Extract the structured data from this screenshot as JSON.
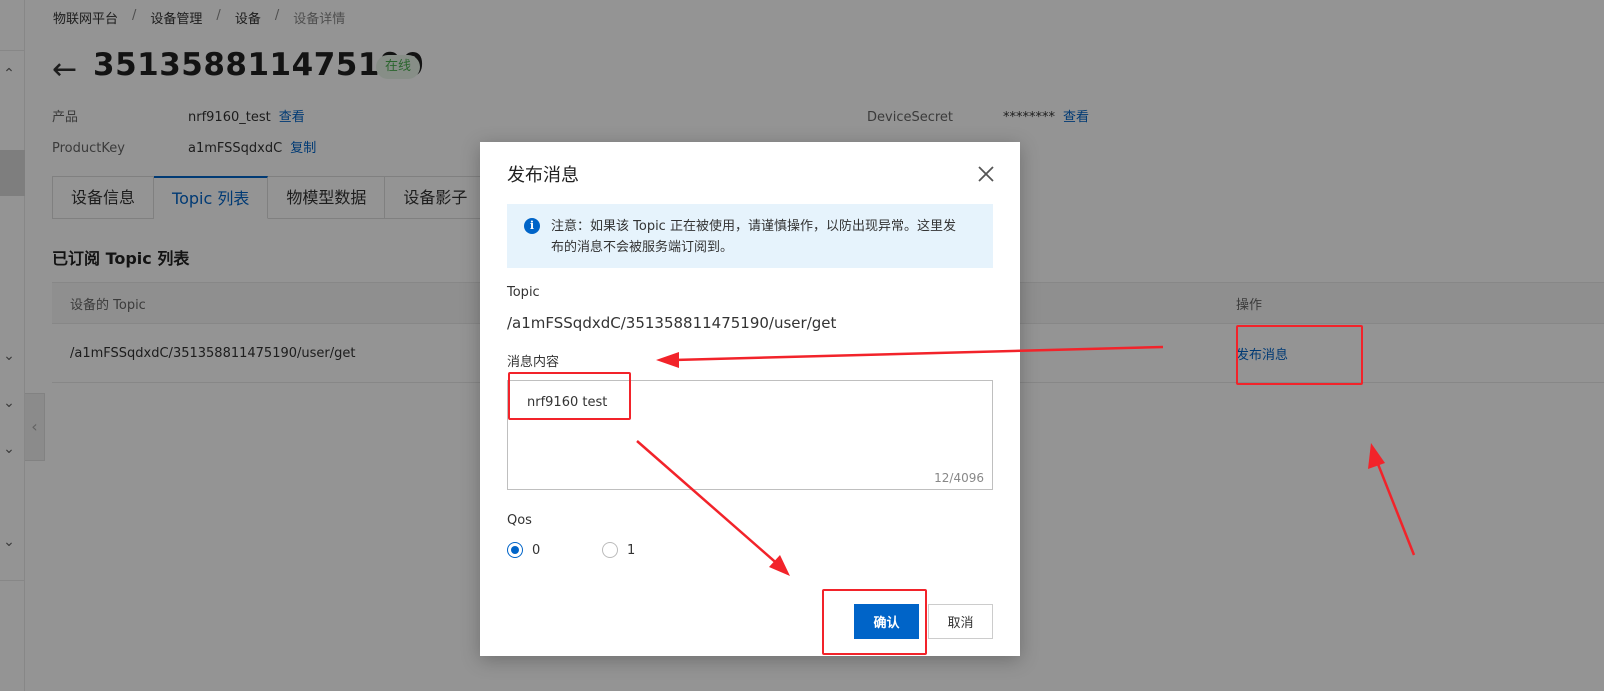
{
  "breadcrumb": {
    "items": [
      "物联网平台",
      "设备管理",
      "设备",
      "设备详情"
    ],
    "separator": "/"
  },
  "device": {
    "name": "351358811475190",
    "status": "在线"
  },
  "meta": {
    "product_label": "产品",
    "product_value": "nrf9160_test",
    "product_link": "查看",
    "productkey_label": "ProductKey",
    "productkey_value": "a1mFSSqdxdC",
    "productkey_link": "复制",
    "secret_label": "DeviceSecret",
    "secret_value": "********",
    "secret_link": "查看"
  },
  "tabs": [
    {
      "label": "设备信息",
      "active": false
    },
    {
      "label": "Topic 列表",
      "active": true
    },
    {
      "label": "物模型数据",
      "active": false
    },
    {
      "label": "设备影子",
      "active": false
    }
  ],
  "section_title": "已订阅 Topic 列表",
  "table": {
    "headers": {
      "topic": "设备的 Topic",
      "ops": "操作"
    },
    "rows": [
      {
        "topic": "/a1mFSSqdxdC/351358811475190/user/get",
        "action": "发布消息"
      }
    ]
  },
  "dialog": {
    "title": "发布消息",
    "notice_line1": "注意：如果该 Topic 正在被使用，请谨慎操作，以防出现异常。这里发",
    "notice_line2": "布的消息不会被服务端订阅到。",
    "topic_label": "Topic",
    "topic_value": "/a1mFSSqdxdC/351358811475190/user/get",
    "content_label": "消息内容",
    "content_value": "nrf9160 test",
    "content_counter": "12/4096",
    "qos_label": "Qos",
    "qos_options": [
      "0",
      "1"
    ],
    "qos_selected": "0",
    "confirm_label": "确认",
    "cancel_label": "取消"
  },
  "colors": {
    "primary": "#0064c8",
    "annotation": "#f2232a",
    "online_badge_bg": "#e8f5e9",
    "online_badge_text": "#4caf50",
    "notice_bg": "#e6f3fc"
  },
  "icons": [
    "back-arrow-icon",
    "close-icon",
    "info-icon",
    "chevron-up-icon",
    "chevron-down-icon",
    "chevron-left-icon"
  ]
}
